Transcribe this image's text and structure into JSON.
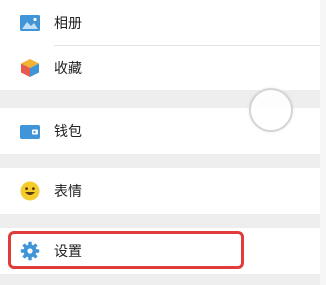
{
  "menu": {
    "items": [
      {
        "label": "相册",
        "icon": "album-icon"
      },
      {
        "label": "收藏",
        "icon": "favorites-cube-icon"
      },
      {
        "label": "钱包",
        "icon": "wallet-icon"
      },
      {
        "label": "表情",
        "icon": "emoji-icon"
      },
      {
        "label": "设置",
        "icon": "settings-gear-icon"
      }
    ]
  },
  "colors": {
    "background": "#eeeeee",
    "row_background": "#ffffff",
    "icon_blue": "#3f95d8",
    "emoji_yellow": "#f4cc2c",
    "highlight_red": "#e03c3c"
  }
}
